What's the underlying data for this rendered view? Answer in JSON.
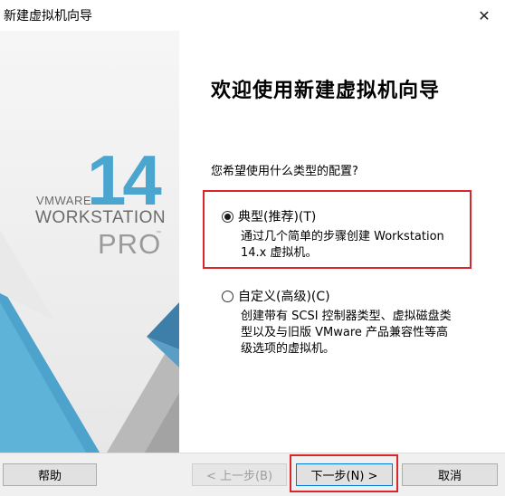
{
  "window": {
    "title": "新建虚拟机向导",
    "close_label": "✕"
  },
  "banner": {
    "version": "14",
    "vendor": "VMWARE",
    "product": "WORKSTATION",
    "edition": "PRO",
    "trademark": "™",
    "accent_color": "#4aa6cf"
  },
  "main": {
    "heading": "欢迎使用新建虚拟机向导",
    "question": "您希望使用什么类型的配置?",
    "options": [
      {
        "label": "典型(推荐)(T)",
        "selected": true,
        "description_lines": [
          "通过几个简单的步骤创建 Workstation",
          "14.x 虚拟机。"
        ]
      },
      {
        "label": "自定义(高级)(C)",
        "selected": false,
        "description_lines": [
          "创建带有 SCSI 控制器类型、虚拟磁盘类",
          "型以及与旧版 VMware 产品兼容性等高",
          "级选项的虚拟机。"
        ]
      }
    ]
  },
  "footer": {
    "help_label": "帮助",
    "back_label": "< 上一步(B)",
    "next_label": "下一步(N) >",
    "cancel_label": "取消"
  },
  "colors": {
    "highlight": "#d9262c",
    "primary_border": "#0078d7"
  }
}
